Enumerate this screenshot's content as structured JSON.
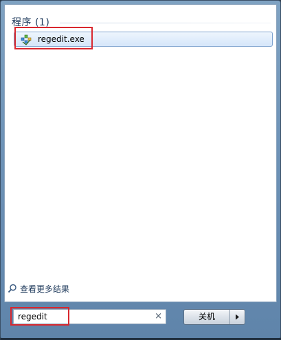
{
  "results": {
    "section_header": "程序 (1)",
    "items": [
      {
        "label": "regedit.exe",
        "icon": "regedit-icon"
      }
    ]
  },
  "see_more": {
    "label": "查看更多结果",
    "icon": "search-icon"
  },
  "search": {
    "value": "regedit",
    "clear_glyph": "×"
  },
  "power": {
    "shutdown_label": "关机",
    "arrow_glyph": "▸"
  },
  "colors": {
    "highlight": "#d9272e",
    "header_text": "#1e395b",
    "selection_bg": "#d5e6fa"
  }
}
